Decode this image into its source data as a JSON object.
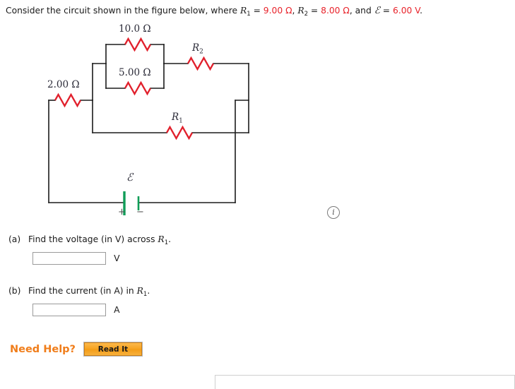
{
  "prompt": {
    "lead": "Consider the circuit shown in the figure below, where ",
    "r1_sym": "R",
    "r1_sub": "1",
    "eq1": " = ",
    "r1_value": "9.00 Ω",
    "sep1": ", ",
    "r2_sym": "R",
    "r2_sub": "2",
    "eq2": " = ",
    "r2_value": "8.00 Ω",
    "sep2": ", and ",
    "emf_sym": "ℰ",
    "eq3": " = ",
    "emf_value": "6.00 V",
    "period": "."
  },
  "figure": {
    "alt": "circuit-diagram",
    "labels": {
      "r_top": "10.0 Ω",
      "r_mid": "5.00 Ω",
      "r_left": "2.00 Ω",
      "r2_sym": "R",
      "r2_sub": "2",
      "r1_sym": "R",
      "r1_sub": "1",
      "emf_sym": "ℰ",
      "plus": "+",
      "minus": "−"
    },
    "colors": {
      "wire": "#1b1b1b",
      "resistor": "#e1202c",
      "battery": "#0f9d58",
      "label": "#2b2b38"
    }
  },
  "info_icon": {
    "glyph": "i",
    "name": "info-icon"
  },
  "questions": [
    {
      "label": "(a)",
      "text_before": "Find the voltage (in V) across ",
      "sym": "R",
      "sub": "1",
      "text_after": ".",
      "value": "",
      "unit": "V"
    },
    {
      "label": "(b)",
      "text_before": "Find the current (in A) in ",
      "sym": "R",
      "sub": "1",
      "text_after": ".",
      "value": "",
      "unit": "A"
    }
  ],
  "need_help": {
    "label": "Need Help?",
    "button_label": "Read It"
  }
}
